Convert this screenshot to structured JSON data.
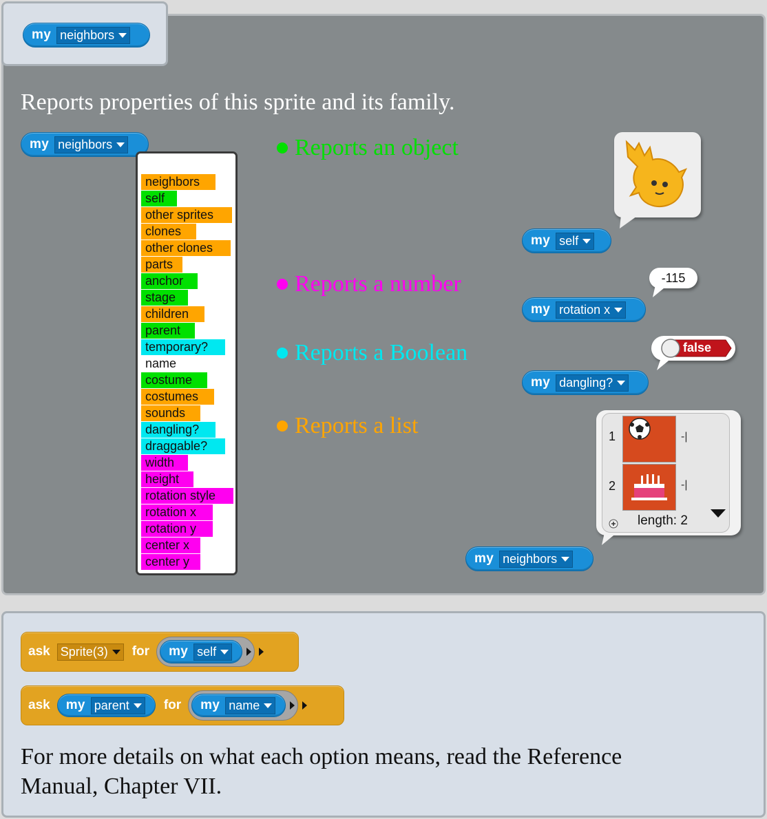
{
  "tab_block": {
    "keyword": "my",
    "option": "neighbors"
  },
  "description": "Reports properties of this sprite and its family.",
  "menu_block": {
    "keyword": "my",
    "option": "neighbors"
  },
  "menu_items": [
    {
      "label": "neighbors",
      "color": "#ffa500"
    },
    {
      "label": "self",
      "color": "#00e000"
    },
    {
      "label": "other sprites",
      "color": "#ffa500"
    },
    {
      "label": "clones",
      "color": "#ffa500"
    },
    {
      "label": "other clones",
      "color": "#ffa500"
    },
    {
      "label": "parts",
      "color": "#ffa500"
    },
    {
      "label": "anchor",
      "color": "#00e000"
    },
    {
      "label": "stage",
      "color": "#00e000"
    },
    {
      "label": "children",
      "color": "#ffa500"
    },
    {
      "label": "parent",
      "color": "#00e000"
    },
    {
      "label": "temporary?",
      "color": "#00e8f0"
    },
    {
      "label": "name",
      "color": "#ffffff"
    },
    {
      "label": "costume",
      "color": "#00e000"
    },
    {
      "label": "costumes",
      "color": "#ffa500"
    },
    {
      "label": "sounds",
      "color": "#ffa500"
    },
    {
      "label": "dangling?",
      "color": "#00e8f0"
    },
    {
      "label": "draggable?",
      "color": "#00e8f0"
    },
    {
      "label": "width",
      "color": "#ff00f0"
    },
    {
      "label": "height",
      "color": "#ff00f0"
    },
    {
      "label": "rotation style",
      "color": "#ff00f0"
    },
    {
      "label": "rotation x",
      "color": "#ff00f0"
    },
    {
      "label": "rotation y",
      "color": "#ff00f0"
    },
    {
      "label": "center x",
      "color": "#ff00f0"
    },
    {
      "label": "center y",
      "color": "#ff00f0"
    }
  ],
  "legend": [
    {
      "text": "Reports an object",
      "color": "#00e000"
    },
    {
      "text": "Reports a number",
      "color": "#ff00f0"
    },
    {
      "text": "Reports a Boolean",
      "color": "#00e8f0"
    },
    {
      "text": "Reports a list",
      "color": "#ffa500"
    }
  ],
  "examples": {
    "self_block": {
      "keyword": "my",
      "option": "self"
    },
    "rotation_block": {
      "keyword": "my",
      "option": "rotation x",
      "result": "-115"
    },
    "dangling_block": {
      "keyword": "my",
      "option": "dangling?",
      "result": "false"
    },
    "neighbors_block": {
      "keyword": "my",
      "option": "neighbors"
    },
    "list": {
      "index_1": "1",
      "index_2": "2",
      "length_label": "length: 2"
    }
  },
  "ask_blocks": [
    {
      "ask": "ask",
      "target": "Sprite(3)",
      "for": "for",
      "keyword": "my",
      "option": "self"
    },
    {
      "ask": "ask",
      "target_keyword": "my",
      "target_option": "parent",
      "for": "for",
      "keyword": "my",
      "option": "name"
    }
  ],
  "footer_text": "For more details on what each option means, read the Reference Manual, Chapter VII.",
  "colors": {
    "reporter_blue": "#1a8fd8",
    "ask_orange": "#e2a321",
    "panel_gray": "#858a8c",
    "false_red": "#c0141b"
  }
}
